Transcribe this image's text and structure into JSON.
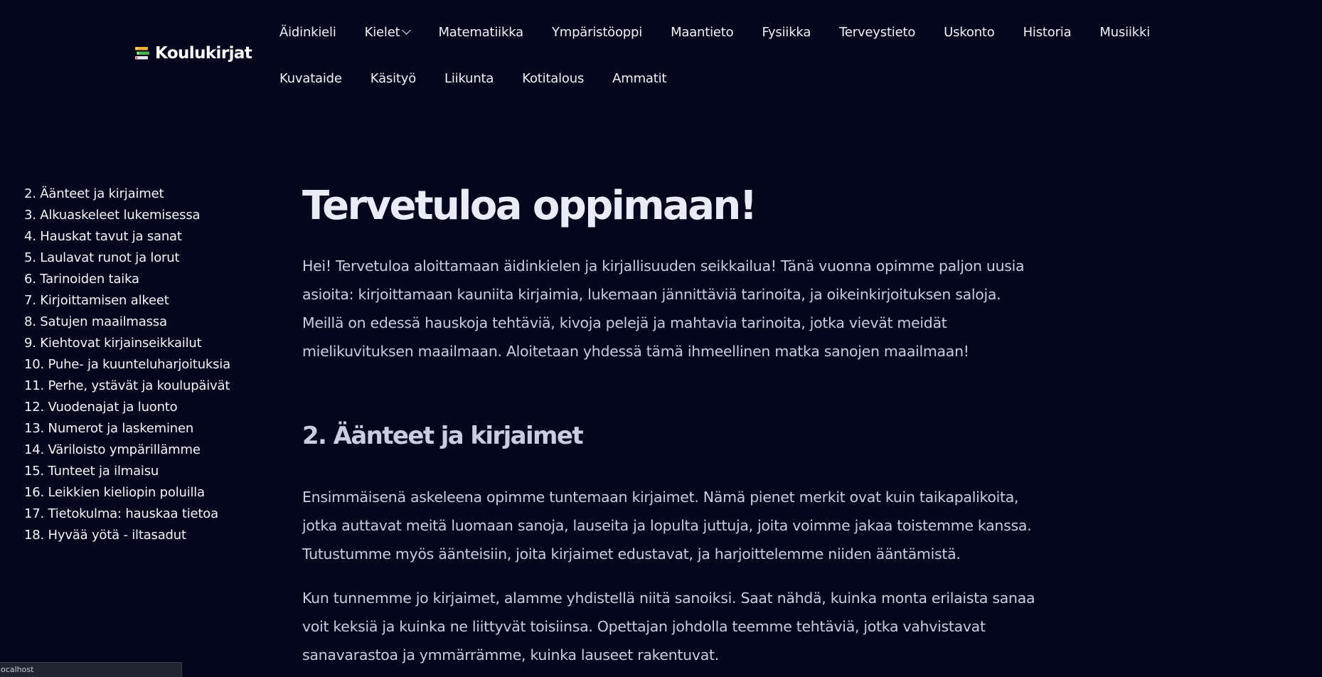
{
  "site": {
    "logo_text": "Koulukirjat",
    "logo_icon": "book-stack-icon"
  },
  "nav": {
    "row1": [
      {
        "label": "Äidinkieli",
        "has_dropdown": false
      },
      {
        "label": "Kielet",
        "has_dropdown": true
      },
      {
        "label": "Matematiikka",
        "has_dropdown": false
      },
      {
        "label": "Ympäristöoppi",
        "has_dropdown": false
      },
      {
        "label": "Maantieto",
        "has_dropdown": false
      },
      {
        "label": "Fysiikka",
        "has_dropdown": false
      },
      {
        "label": "Terveystieto",
        "has_dropdown": false
      },
      {
        "label": "Uskonto",
        "has_dropdown": false
      },
      {
        "label": "Historia",
        "has_dropdown": false
      },
      {
        "label": "Musiikki",
        "has_dropdown": false
      }
    ],
    "row2": [
      {
        "label": "Kuvataide"
      },
      {
        "label": "Käsityö"
      },
      {
        "label": "Liikunta"
      },
      {
        "label": "Kotitalous"
      },
      {
        "label": "Ammatit"
      }
    ]
  },
  "toc": {
    "items": [
      "2. Äänteet ja kirjaimet",
      "3. Alkuaskeleet lukemisessa",
      "4. Hauskat tavut ja sanat",
      "5. Laulavat runot ja lorut",
      "6. Tarinoiden taika",
      "7. Kirjoittamisen alkeet",
      "8. Satujen maailmassa",
      "9. Kiehtovat kirjainseikkailut",
      "10. Puhe- ja kuunteluharjoituksia",
      "11. Perhe, ystävät ja koulupäivät",
      "12. Vuodenajat ja luonto",
      "13. Numerot ja laskeminen",
      "14. Väriloisto ympärillämme",
      "15. Tunteet ja ilmaisu",
      "16. Leikkien kieliopin poluilla",
      "17. Tietokulma: hauskaa tietoa",
      "18. Hyvää yötä - iltasadut"
    ]
  },
  "main": {
    "title": "Tervetuloa oppimaan!",
    "intro": "Hei! Tervetuloa aloittamaan äidinkielen ja kirjallisuuden seikkailua! Tänä vuonna opimme paljon uusia asioita: kirjoittamaan kauniita kirjaimia, lukemaan jännittäviä tarinoita, ja oikeinkirjoituksen saloja. Meillä on edessä hauskoja tehtäviä, kivoja pelejä ja mahtavia tarinoita, jotka vievät meidät mielikuvituksen maailmaan. Aloitetaan yhdessä tämä ihmeellinen matka sanojen maailmaan!",
    "section_title": "2. Äänteet ja kirjaimet",
    "section_p1": "Ensimmäisenä askeleena opimme tuntemaan kirjaimet. Nämä pienet merkit ovat kuin taikapalikoita, jotka auttavat meitä luomaan sanoja, lauseita ja lopulta juttuja, joita voimme jakaa toistemme kanssa. Tutustumme myös äänteisiin, joita kirjaimet edustavat, ja harjoittelemme niiden ääntämistä.",
    "section_p2": "Kun tunnemme jo kirjaimet, alamme yhdistellä niitä sanoiksi. Saat nähdä, kuinka monta erilaista sanaa voit keksiä ja kuinka ne liittyvät toisiinsa. Opettajan johdolla teemme tehtäviä, jotka vahvistavat sanavarastoa ja ymmärrämme, kuinka lauseet rakentuvat."
  },
  "statusbar": {
    "text": "localhost"
  },
  "colors": {
    "background": "#03061c",
    "title": "#e9ecf6",
    "body_text": "#c9cedd",
    "nav_text": "#f0f2f8"
  }
}
